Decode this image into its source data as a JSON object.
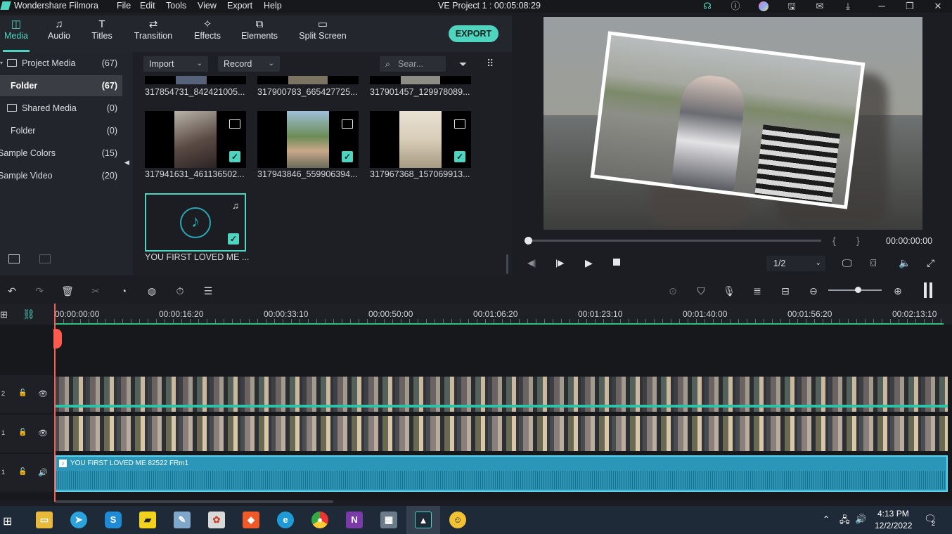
{
  "titlebar": {
    "app_name": "Wondershare Filmora",
    "menu": [
      "File",
      "Edit",
      "Tools",
      "View",
      "Export",
      "Help"
    ],
    "project": "VE Project 1 : 00:05:08:29"
  },
  "tabs": [
    "Media",
    "Audio",
    "Titles",
    "Transition",
    "Effects",
    "Elements",
    "Split Screen"
  ],
  "export_label": "EXPORT",
  "library": [
    {
      "label": "Project Media",
      "count": "(67)"
    },
    {
      "label": "Folder",
      "count": "(67)"
    },
    {
      "label": "Shared Media",
      "count": "(0)"
    },
    {
      "label": "Folder",
      "count": "(0)"
    },
    {
      "label": "Sample Colors",
      "count": "(15)"
    },
    {
      "label": "Sample Video",
      "count": "(20)"
    }
  ],
  "media_toolbar": {
    "import": "Import",
    "record": "Record",
    "search_placeholder": "Sear..."
  },
  "media_items": [
    {
      "name": "317854731_842421005..."
    },
    {
      "name": "317900783_665427725..."
    },
    {
      "name": "317901457_129978089..."
    },
    {
      "name": "317941631_461136502..."
    },
    {
      "name": "317943846_559906394..."
    },
    {
      "name": "317967368_157069913..."
    },
    {
      "name": "YOU FIRST LOVED ME ..."
    }
  ],
  "preview": {
    "timecode": "00:00:00:00",
    "quality": "1/2"
  },
  "ruler": [
    "00:00:00:00",
    "00:00:16:20",
    "00:00:33:10",
    "00:00:50:00",
    "00:01:06:20",
    "00:01:23:10",
    "00:01:40:00",
    "00:01:56:20",
    "00:02:13:10"
  ],
  "tracks": {
    "v2": "2",
    "v1": "1",
    "a1": "1"
  },
  "audio_clip": "YOU FIRST LOVED ME 82522 FRm1",
  "tray": {
    "time": "4:13 PM",
    "date": "12/2/2022",
    "notif": "2"
  }
}
